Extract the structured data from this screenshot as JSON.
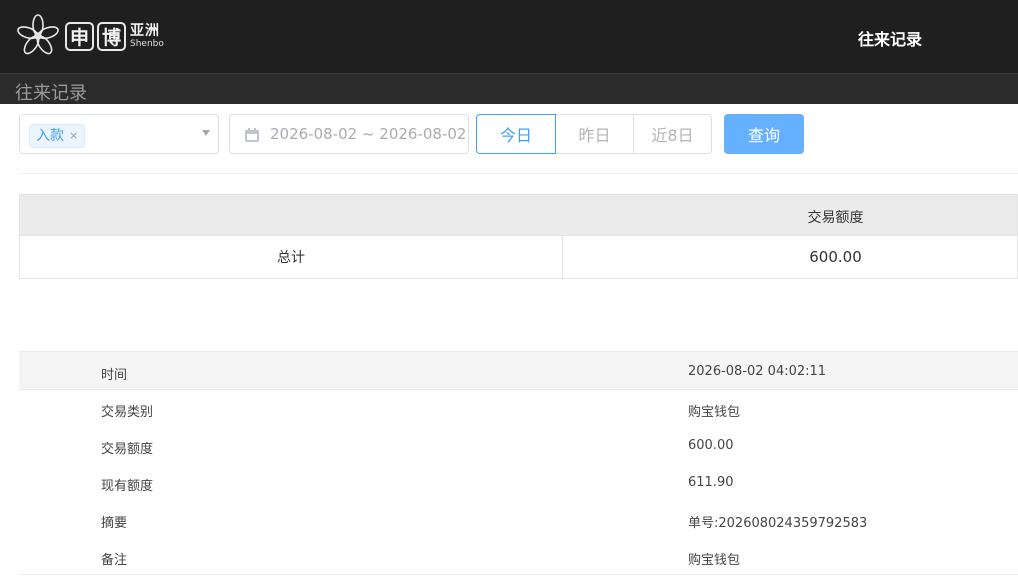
{
  "header": {
    "logo": {
      "box1": "申",
      "box2": "博",
      "cn": "亚洲",
      "en": "Shenbo"
    },
    "title": "往来记录"
  },
  "subbar": {
    "title": "往来记录"
  },
  "filters": {
    "type_tag": "入款",
    "tag_close": "×",
    "date_range": "2026-08-02 ~ 2026-08-02",
    "ranges": [
      "今日",
      "昨日",
      "近8日"
    ],
    "active_range": "今日",
    "query_label": "查询"
  },
  "summary": {
    "header": "交易额度",
    "row_label": "总计",
    "row_value": "600.00"
  },
  "detail": {
    "rows": [
      {
        "label": "时间",
        "value": "2026-08-02 04:02:11"
      },
      {
        "label": "交易类别",
        "value": "购宝钱包"
      },
      {
        "label": "交易额度",
        "value": "600.00"
      },
      {
        "label": "现有额度",
        "value": "611.90"
      },
      {
        "label": "摘要",
        "value": "单号:202608024359792583"
      },
      {
        "label": "备注",
        "value": "购宝钱包"
      }
    ]
  },
  "colors": {
    "header_bg": "#1f1f1f",
    "accent": "#409eff",
    "query_button": "#66b1ff"
  }
}
